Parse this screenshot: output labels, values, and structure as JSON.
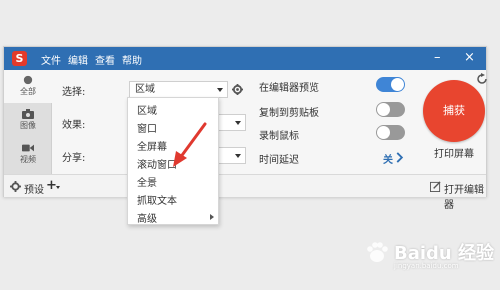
{
  "app": {
    "logo_letter": "S",
    "menu": [
      "文件",
      "编辑",
      "查看",
      "帮助"
    ],
    "controls": {
      "minimize": "–",
      "close": "×"
    }
  },
  "sidebar": {
    "items": [
      {
        "label": "全部",
        "icon": "all-icon",
        "active": true
      },
      {
        "label": "图像",
        "icon": "camera-icon",
        "active": false
      },
      {
        "label": "视频",
        "icon": "video-icon",
        "active": false
      }
    ]
  },
  "form": {
    "select_label": "选择:",
    "select_value": "区域",
    "effect_label": "效果:",
    "share_label": "分享:"
  },
  "options": {
    "preview_label": "在编辑器预览",
    "preview_on": true,
    "clipboard_label": "复制到剪贴板",
    "clipboard_on": false,
    "cursor_label": "录制鼠标",
    "cursor_on": false,
    "delay_label": "时间延迟",
    "delay_value": "关"
  },
  "capture": {
    "button_label": "捕获",
    "print_screen_label": "打印屏幕"
  },
  "bottom": {
    "presets_label": "预设",
    "add_label": "+",
    "open_editor_label": "打开编辑器"
  },
  "dropdown": {
    "items": [
      "区域",
      "窗口",
      "全屏幕",
      "滚动窗口",
      "全景",
      "抓取文本",
      "高级"
    ],
    "highlighted": "滚动窗口"
  },
  "watermark": {
    "text": "Baidu 经验",
    "sub": "jingyan.baidu.com"
  },
  "colors": {
    "titlebar": "#2f6fb3",
    "capture": "#e8452f",
    "toggle_on": "#3f85d6",
    "annotation": "#e0392f"
  }
}
